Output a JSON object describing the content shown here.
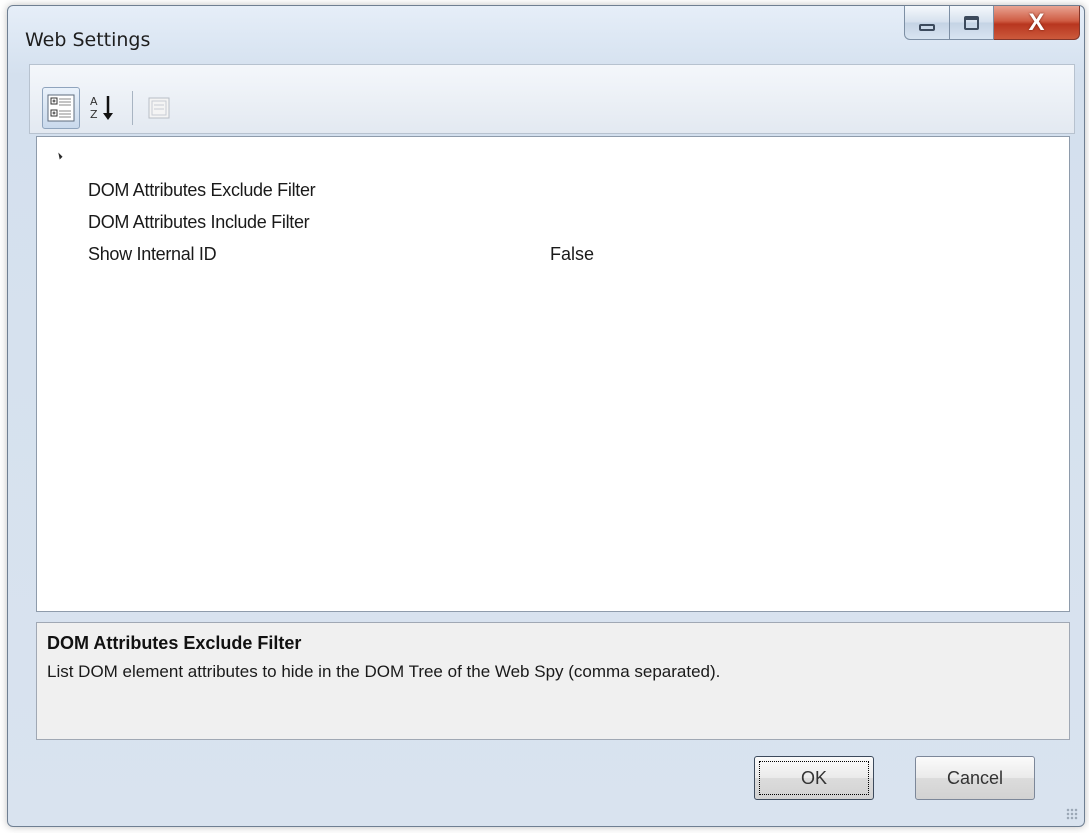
{
  "window": {
    "title": "Web Settings"
  },
  "caption_buttons": {
    "minimize_icon": "minimize-icon",
    "maximize_icon": "maximize-icon",
    "close_icon": "close-icon",
    "close_glyph": "X"
  },
  "toolbar": {
    "buttons": [
      {
        "name": "categorized",
        "icon": "categorized-icon",
        "pressed": true
      },
      {
        "name": "alphabetical",
        "icon": "sort-alphabetical-icon",
        "pressed": false
      },
      {
        "name": "property-pages",
        "icon": "property-pages-icon",
        "enabled": false
      }
    ]
  },
  "grid": {
    "category_expanded": true,
    "properties": [
      {
        "name": "DOM Attributes Exclude Filter",
        "value": ""
      },
      {
        "name": "DOM Attributes Include Filter",
        "value": ""
      },
      {
        "name": "Show Internal ID",
        "value": "False"
      }
    ]
  },
  "help": {
    "title": "DOM Attributes Exclude Filter",
    "description": "List DOM element attributes to hide in the DOM Tree of the Web Spy (comma separated)."
  },
  "buttons": {
    "ok": "OK",
    "cancel": "Cancel"
  }
}
